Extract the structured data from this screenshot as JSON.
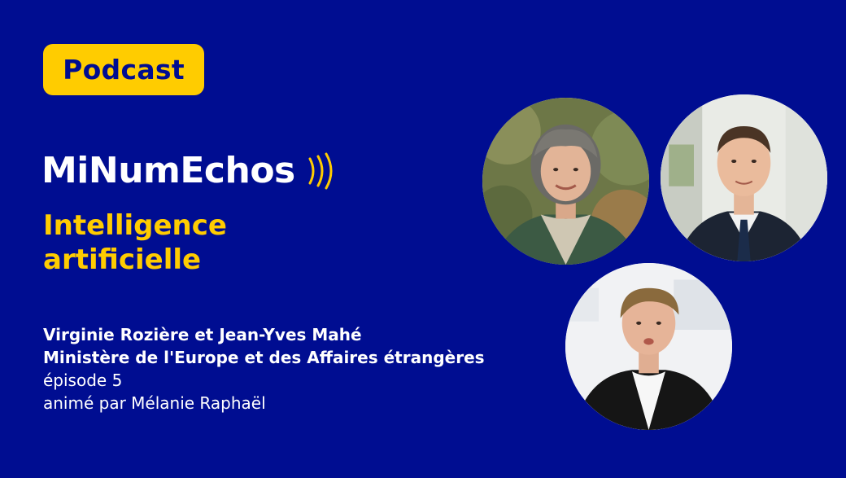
{
  "badge": {
    "label": "Podcast",
    "bg_color": "#ffcc00",
    "text_color": "#000d91"
  },
  "brand": {
    "title": "MiNumEchos",
    "icon": "sound-waves-icon"
  },
  "subject": {
    "line1": "Intelligence",
    "line2": "artificielle",
    "color": "#ffcc00"
  },
  "details": {
    "guests": "Virginie Rozière et Jean-Yves Mahé",
    "ministry": "Ministère de l'Europe et des Affaires étrangères",
    "episode": "épisode 5",
    "host": "animé par Mélanie Raphaël"
  },
  "colors": {
    "background": "#000d91",
    "accent": "#ffcc00",
    "text": "#ffffff"
  }
}
